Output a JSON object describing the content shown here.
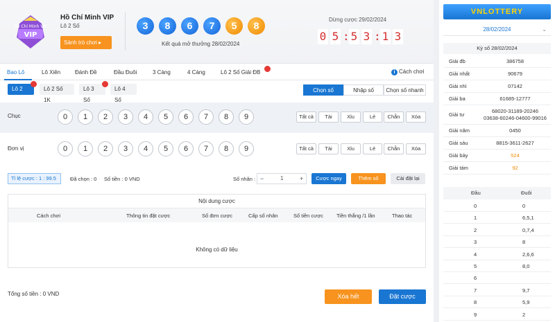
{
  "header": {
    "game_name": "Hồ Chí Minh VIP",
    "game_sub": "Lô 2 Số",
    "lobby_button": "Sảnh trò chơi ▸",
    "logo_text": "Hồ Chí Minh VIP",
    "balls": [
      "3",
      "8",
      "6",
      "7",
      "5",
      "8"
    ],
    "ball_colors": [
      "blue",
      "blue",
      "blue",
      "blue",
      "orange",
      "orange"
    ],
    "result_date": "Kết quả mở thưởng 28/02/2024",
    "stop_label": "Dừng cược 29/02/2024",
    "countdown": [
      "0",
      "5",
      ":",
      "5",
      "3",
      ":",
      "1",
      "3"
    ]
  },
  "tabs": [
    "Bao Lô",
    "Lô Xiên",
    "Đánh Đề",
    "Đầu Đuôi",
    "3 Càng",
    "4 Càng",
    "Lô 2 Số Giải ĐB"
  ],
  "guide": "Cách chơi",
  "subtypes": [
    "Lô 2 Số",
    "Lô 2 Số 1K",
    "Lô 3 Số",
    "Lô 4 Số"
  ],
  "modes": [
    "Chọn số",
    "Nhập số",
    "Chọn số nhanh"
  ],
  "rows": [
    {
      "label": "Chục"
    },
    {
      "label": "Đơn vị"
    }
  ],
  "numbers": [
    "0",
    "1",
    "2",
    "3",
    "4",
    "5",
    "6",
    "7",
    "8",
    "9"
  ],
  "quick": [
    "Tất cả",
    "Tài",
    "Xỉu",
    "Lẻ",
    "Chẵn",
    "Xóa"
  ],
  "betbar": {
    "rate": "Tỉ lệ cược : 1 : 99.5",
    "selected": "Đã chọn : 0",
    "amount": "Số tiền : 0 VND",
    "multiplier_label": "Số nhân :",
    "multiplier_value": "1",
    "bet_now": "Cược ngay",
    "add_number": "Thêm số",
    "reset": "Cài đặt lại"
  },
  "table": {
    "title": "Nội dung cược",
    "columns": [
      "Cách chơi",
      "Thông tin đặt cược",
      "Số đơn cược",
      "Cấp số nhân",
      "Số tiền cược",
      "Tiền thắng /1 lần",
      "Thao tác"
    ],
    "empty": "Không có dữ liệu"
  },
  "footer": {
    "total": "Tổng số tiền : 0 VND",
    "clear_all": "Xóa hết",
    "place_bet": "Đặt cược"
  },
  "results": {
    "brand": "VNLOTTERY",
    "date": "28/02/2024",
    "draw_label": "Kỳ số 28/02/2024",
    "prizes": [
      {
        "label": "Giải đb",
        "value": "386758"
      },
      {
        "label": "Giải nhất",
        "value": "90679"
      },
      {
        "label": "Giải nhì",
        "value": "07142"
      },
      {
        "label": "Giải ba",
        "value": "61685-12777"
      },
      {
        "label": "Giải tư",
        "value": "68020-31189-20246",
        "value2": "03638-60246-04600-99016"
      },
      {
        "label": "Giải năm",
        "value": "0450"
      },
      {
        "label": "Giải sáu",
        "value": "8815-3611-2627"
      },
      {
        "label": "Giải bảy",
        "value": "524"
      },
      {
        "label": "Giải tám",
        "value": "92"
      }
    ],
    "head_tail_cols": [
      "Đầu",
      "Đuôi"
    ],
    "head_tail": [
      {
        "dau": "0",
        "duoi": "0"
      },
      {
        "dau": "1",
        "duoi": "6,5,1"
      },
      {
        "dau": "2",
        "duoi": "0,7,4"
      },
      {
        "dau": "3",
        "duoi": "8"
      },
      {
        "dau": "4",
        "duoi": "2,6,6"
      },
      {
        "dau": "5",
        "duoi": "8,0"
      },
      {
        "dau": "6",
        "duoi": ""
      },
      {
        "dau": "7",
        "duoi": "9,7"
      },
      {
        "dau": "8",
        "duoi": "5,9"
      },
      {
        "dau": "9",
        "duoi": "2"
      }
    ]
  }
}
